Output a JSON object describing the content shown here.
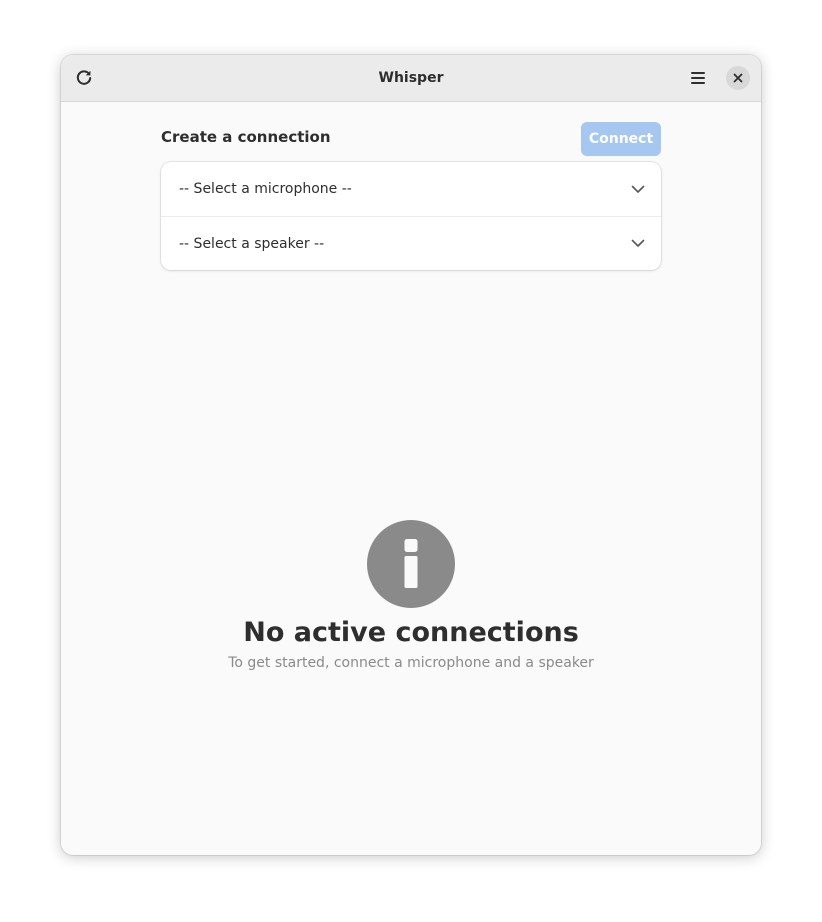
{
  "window": {
    "title": "Whisper"
  },
  "headerbar": {
    "refresh_icon": "view-refresh-icon",
    "menu_icon": "open-menu-icon",
    "close_icon": "window-close-icon"
  },
  "connection": {
    "heading": "Create a connection",
    "connect_label": "Connect",
    "microphone_select": "-- Select a microphone --",
    "speaker_select": "-- Select a speaker --",
    "chevron_icon": "chevron-down-icon"
  },
  "status": {
    "icon": "info-icon",
    "title": "No active connections",
    "description": "To get started, connect a microphone and a speaker"
  },
  "colors": {
    "accent_disabled": "#a6c7ef",
    "window_bg": "#fafafa",
    "headerbar_bg": "#ebebeb",
    "status_icon": "#8a8a8a"
  }
}
